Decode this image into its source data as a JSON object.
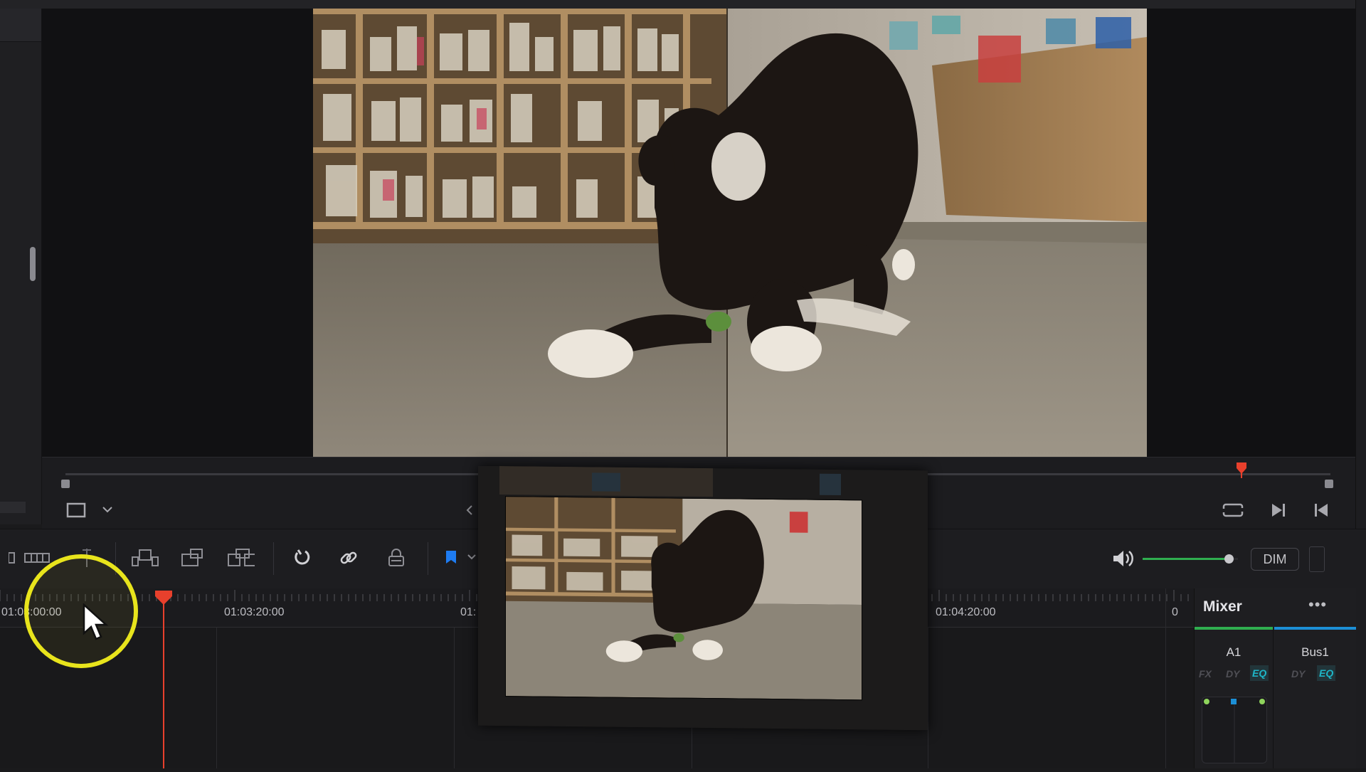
{
  "timeline": {
    "ruler_labels": [
      "01:03:00:00",
      "01:03:20:00",
      "01:",
      "01:04:20:00",
      "0"
    ]
  },
  "viewer": {
    "audio_dim_label": "DIM",
    "volume_level": 0.9
  },
  "mixer": {
    "title": "Mixer",
    "channels": [
      {
        "name": "A1",
        "buttons": [
          "FX",
          "DY",
          "EQ"
        ]
      },
      {
        "name": "Bus1",
        "buttons": [
          "DY",
          "EQ"
        ]
      }
    ]
  },
  "colors": {
    "playhead": "#e8402c",
    "flag": "#1e7cf2",
    "accent_green": "#2fae4f",
    "accent_blue": "#1c8fd6",
    "cursor_highlight": "#e8e41c"
  },
  "icons": [
    "crop-icon",
    "chevron-down-icon",
    "loop-icon",
    "next-frame-icon",
    "prev-frame-icon",
    "trim-icon",
    "blade-icon",
    "insert-icon",
    "overwrite-icon",
    "replace-icon",
    "snap-icon",
    "link-icon",
    "lock-icon",
    "flag-icon",
    "speaker-icon",
    "more-icon"
  ]
}
